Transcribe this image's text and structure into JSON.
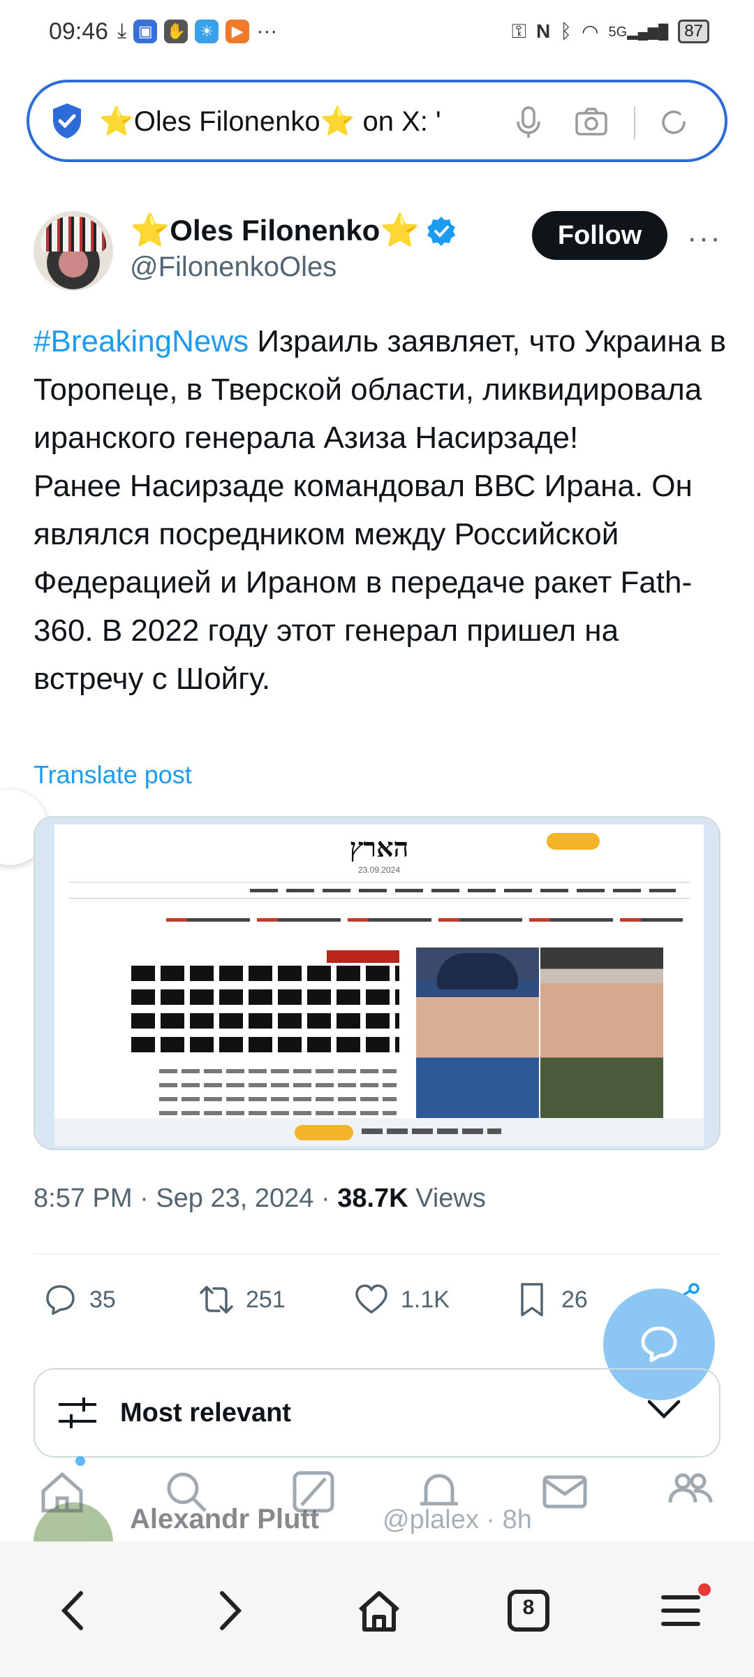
{
  "status_bar": {
    "time": "09:46",
    "network": "5G",
    "battery": "87",
    "icons": [
      "download-icon",
      "shield-app-icon",
      "hand-app-icon",
      "weather-app-icon",
      "play-app-icon",
      "more-dots-icon",
      "key-icon",
      "nfc-icon",
      "bluetooth-icon",
      "wifi-icon",
      "signal-icon"
    ]
  },
  "address_bar": {
    "text": "⭐Oles Filonenko⭐ on X: '"
  },
  "tweet": {
    "author_name": "Oles Filonenko",
    "author_prefix_star": "⭐",
    "author_suffix_star": "⭐",
    "handle": "@FilonenkoOles",
    "follow_label": "Follow",
    "more_label": "···",
    "hashtag": "#BreakingNews",
    "body": " Израиль заявляет, что Украина в Торопеце, в Тверской области, ликвидировала иранского генерала Азиза Насирзаде!\nРанее Насирзаде командовал ВВС Ирана. Он являлся посредником между Российской Федерацией и Ираном в передаче ракет Fath-360. В 2022 году этот генерал пришел на встречу с Шойгу.",
    "translate_label": "Translate post",
    "time": "8:57 PM",
    "date": "Sep 23, 2024",
    "views_count": "38.7K",
    "views_label": "Views",
    "separator": "·",
    "embedded_image": {
      "masthead": "הארץ",
      "date_line": "23.09.2024"
    },
    "replies": "35",
    "reposts": "251",
    "likes": "1.1K",
    "bookmarks": "26"
  },
  "sort": {
    "label": "Most relevant"
  },
  "reply_preview": {
    "name": "Alexandr Plutt",
    "meta": "@plalex · 8h"
  },
  "browser_nav": {
    "tabs_count": "8"
  },
  "colors": {
    "accent": "#1d9bf0",
    "address_border": "#2d6bd9",
    "text": "#0f1419",
    "muted": "#536471",
    "fab": "#8cc7f4"
  }
}
